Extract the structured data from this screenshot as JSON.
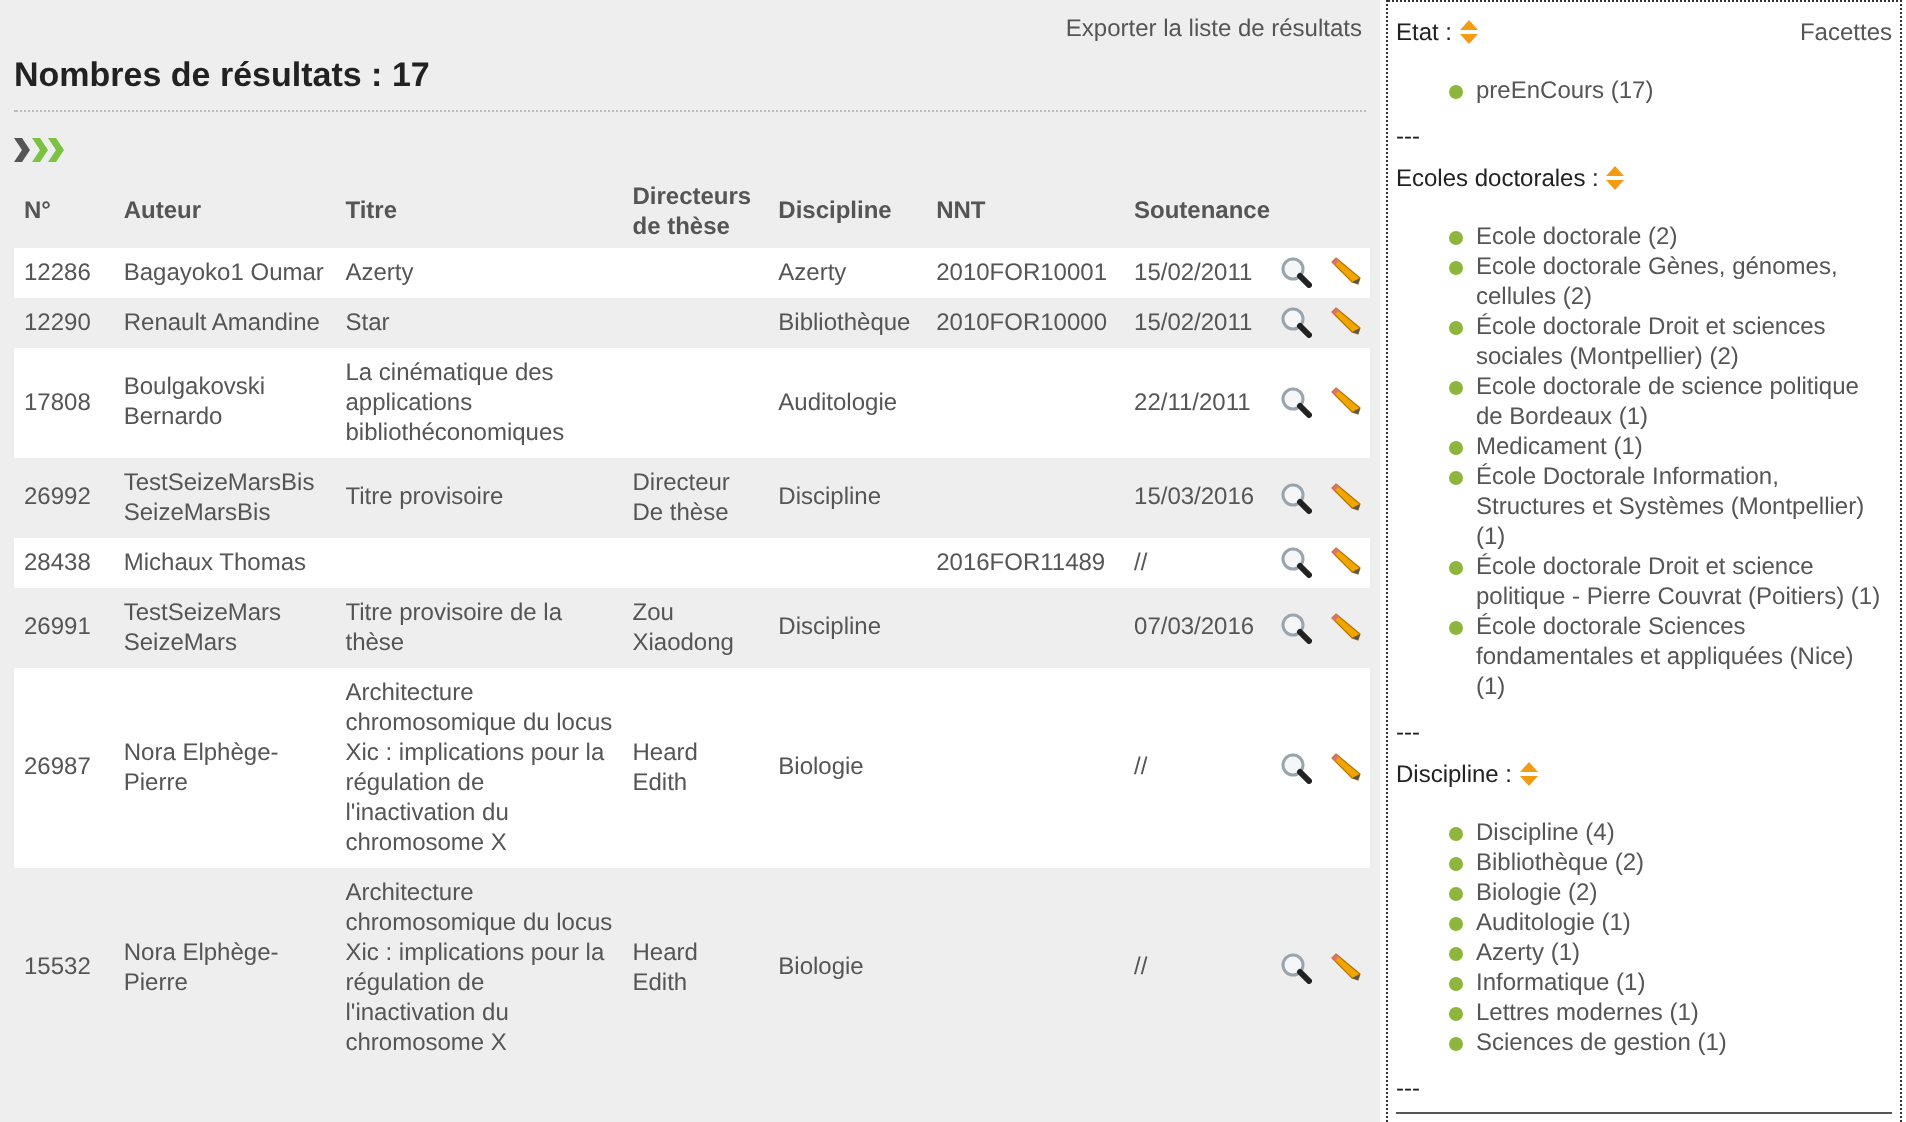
{
  "results": {
    "title": "Nombres de résultats : 17",
    "export_link": "Exporter la liste de résultats"
  },
  "table": {
    "columns": [
      "N°",
      "Auteur",
      "Titre",
      "Directeurs de thèse",
      "Discipline",
      "NNT",
      "Soutenance"
    ],
    "rows": [
      {
        "cells": [
          "12286",
          "Bagayoko1 Oumar",
          "Azerty",
          "",
          "Azerty",
          "2010FOR10001",
          "15/02/2011"
        ]
      },
      {
        "cells": [
          "12290",
          "Renault Amandine",
          "Star",
          "",
          "Bibliothèque",
          "2010FOR10000",
          "15/02/2011"
        ]
      },
      {
        "cells": [
          "17808",
          "Boulgakovski Bernardo",
          "La cinématique des applications bibliothéconomiques",
          "",
          "Auditologie",
          "",
          "22/11/2011"
        ]
      },
      {
        "cells": [
          "26992",
          "TestSeizeMarsBis SeizeMarsBis",
          "Titre provisoire",
          "Directeur De thèse",
          "Discipline",
          "",
          "15/03/2016"
        ]
      },
      {
        "cells": [
          "28438",
          "Michaux Thomas",
          "",
          "",
          "",
          "2016FOR11489",
          "//"
        ]
      },
      {
        "cells": [
          "26991",
          "TestSeizeMars SeizeMars",
          "Titre provisoire de la thèse",
          "Zou Xiaodong",
          "Discipline",
          "",
          "07/03/2016"
        ]
      },
      {
        "cells": [
          "26987",
          "Nora Elphège-Pierre",
          "Architecture chromosomique du locus Xic : implications pour la régulation de l'inactivation du chromosome X",
          "Heard Edith",
          "Biologie",
          "",
          "//"
        ]
      },
      {
        "cells": [
          "15532",
          "Nora Elphège-Pierre",
          "Architecture chromosomique du locus Xic : implications pour la régulation de l'inactivation du chromosome X",
          "Heard Edith",
          "Biologie",
          "",
          "//"
        ]
      }
    ]
  },
  "facets": {
    "title": "Facettes",
    "separator": "---",
    "groups": [
      {
        "label": "Etat :",
        "items": [
          "preEnCours (17)"
        ]
      },
      {
        "label": "Ecoles doctorales :",
        "items": [
          "Ecole doctorale (2)",
          "Ecole doctorale Gènes, génomes, cellules (2)",
          "École doctorale Droit et sciences sociales (Montpellier) (2)",
          "Ecole doctorale de science politique de Bordeaux (1)",
          "Medicament (1)",
          "École Doctorale Information, Structures et Systèmes (Montpellier) (1)",
          "École doctorale Droit et science politique - Pierre Couvrat (Poitiers) (1)",
          "École doctorale Sciences fondamentales et appliquées (Nice) (1)"
        ]
      },
      {
        "label": "Discipline :",
        "items": [
          "Discipline (4)",
          "Bibliothèque (2)",
          "Biologie (2)",
          "Auditologie (1)",
          "Azerty (1)",
          "Informatique (1)",
          "Lettres modernes (1)",
          "Sciences de gestion (1)"
        ]
      }
    ]
  }
}
